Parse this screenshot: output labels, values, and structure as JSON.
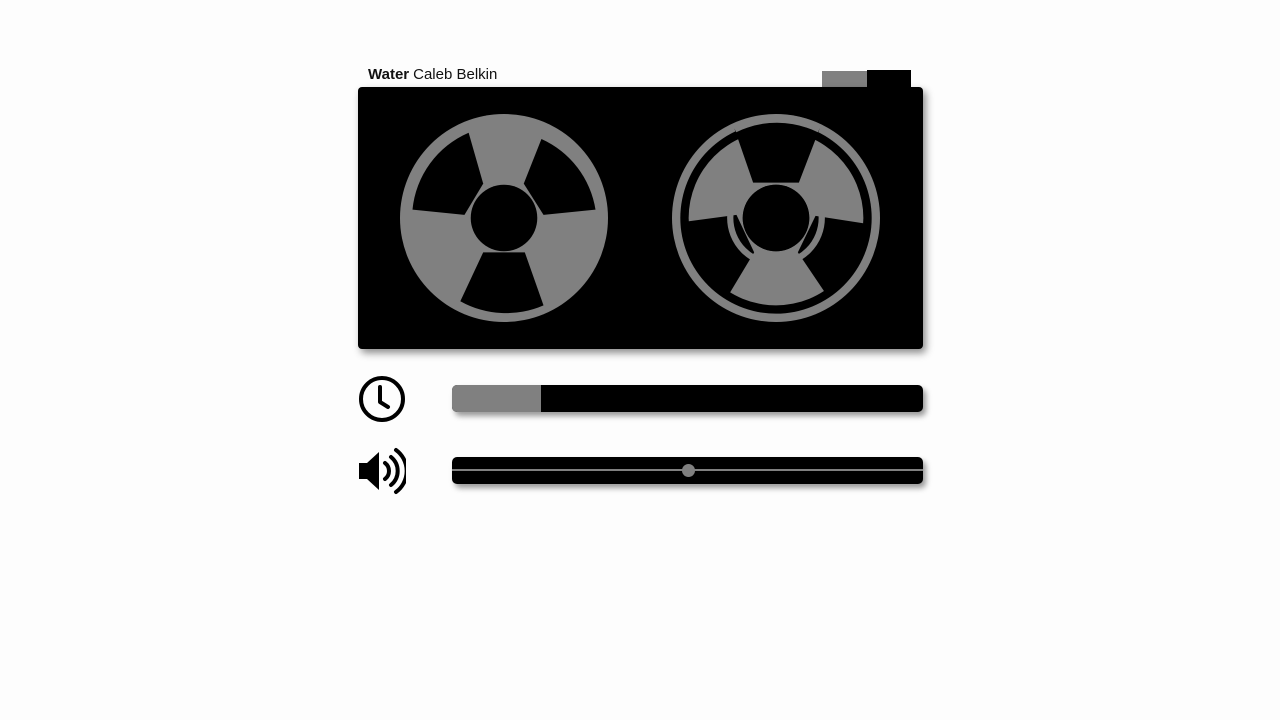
{
  "track": {
    "title": "Water",
    "artist": "Caleb Belkin"
  },
  "colors": {
    "reel": "#808080",
    "panel": "#000000",
    "accent": "#808080",
    "background": "#fdfdfd"
  },
  "icons": {
    "reel": "tape-reel-icon",
    "time": "clock-icon",
    "volume": "speaker-volume-icon"
  },
  "tabs": [
    "tab-left",
    "tab-right"
  ],
  "playback": {
    "progress": 0.19
  },
  "volume": {
    "level": 0.5
  }
}
